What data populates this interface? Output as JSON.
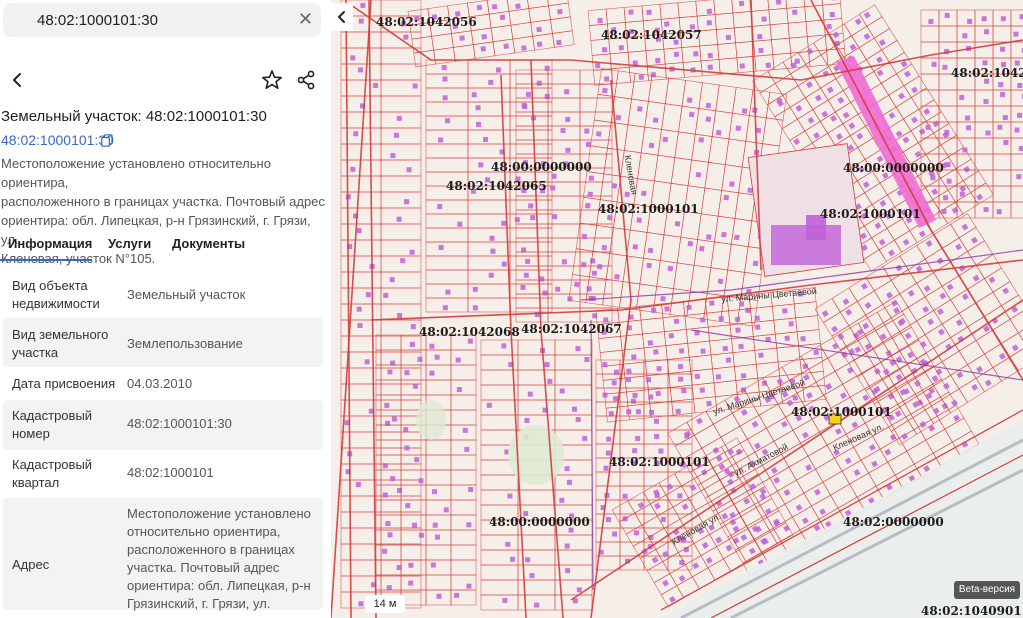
{
  "search": {
    "query": "48:02:1000101:30",
    "clear_icon": "close-icon"
  },
  "header": {
    "back_icon": "chevron-left-icon",
    "favorite_icon": "star-icon",
    "share_icon": "share-icon"
  },
  "parcel": {
    "title": "Земельный участок: 48:02:1000101:30",
    "cadastral_link": "48:02:1000101:30",
    "copy_icon": "copy-icon",
    "location_lines": [
      "Местоположение установлено относительно ориентира,",
      "расположенного в границах участка. Почтовый адрес",
      "ориентира: обл. Липецкая, р-н Грязинский, г. Грязи, ул.",
      "Кленовая, участок N°105."
    ]
  },
  "tabs": {
    "info": "Информация",
    "services": "Услуги",
    "docs": "Документы",
    "active": "info"
  },
  "properties": [
    {
      "label": [
        "Вид объекта",
        "недвижимости"
      ],
      "value": [
        "Земельный участок"
      ]
    },
    {
      "label": [
        "Вид земельного",
        "участка"
      ],
      "value": [
        "Землепользование"
      ]
    },
    {
      "label": [
        "Дата присвоения"
      ],
      "value": [
        "04.03.2010"
      ]
    },
    {
      "label": [
        "Кадастровый",
        "номер"
      ],
      "value": [
        "48:02:1000101:30"
      ]
    },
    {
      "label": [
        "Кадастровый",
        "квартал"
      ],
      "value": [
        "48:02:1000101"
      ]
    },
    {
      "label": [
        "Адрес"
      ],
      "value": [
        "Местоположение установлено",
        "относительно ориентира,",
        "расположенного в границах",
        "участка. Почтовый адрес",
        "ориентира: обл. Липецкая, р-н",
        "Грязинский, г. Грязи, ул."
      ]
    }
  ],
  "map": {
    "back_icon": "chevron-left-icon",
    "scale": "14 м",
    "badge": "Beta-версия",
    "cadastral_labels": [
      "48:02:1042056",
      "48:02:1042057",
      "48:02:1042",
      "48:00:0000000",
      "48:02:1042065",
      "48:00:0000000",
      "48:02:1000101",
      "48:02:1000101",
      "48:02:1042068",
      "48:02:1042067",
      "48:02:1000101",
      "48:02:1000101",
      "48:00:0000000",
      "48:02:0000000",
      "48:02:1040901"
    ],
    "streets": [
      "ул. Марины Цветаевой",
      "ул. Марины Цветаевой",
      "Кленовая ул.",
      "Кленовая ул.",
      "ул. Ахматовой",
      "Кленовая"
    ],
    "colors": {
      "background": "#f6eee8",
      "boundary": "#d23c3c",
      "highlight": "#f06cd4",
      "building": "#c060d8",
      "road": "#b8bcc4"
    }
  }
}
